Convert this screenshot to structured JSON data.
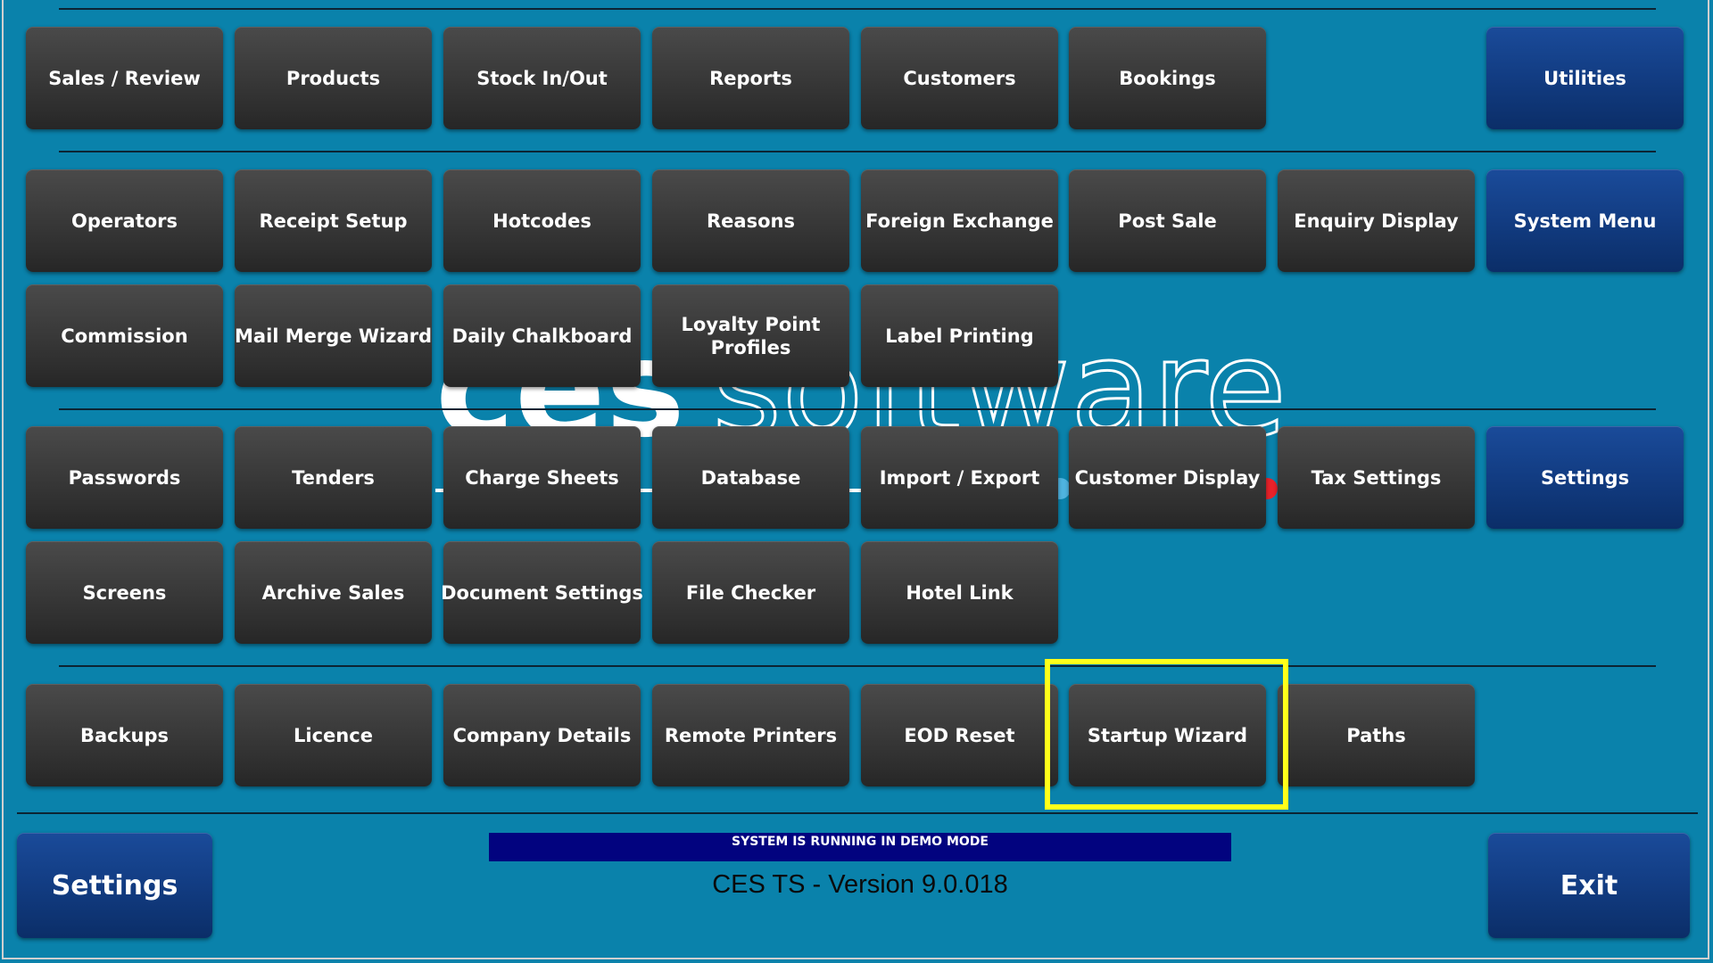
{
  "watermark": {
    "brand_bold": "ces",
    "brand_light": "software"
  },
  "rows": {
    "row1": [
      "Sales / Review",
      "Products",
      "Stock In/Out",
      "Reports",
      "Customers",
      "Bookings"
    ],
    "row1_utility": "Utilities",
    "row2": [
      "Operators",
      "Receipt Setup",
      "Hotcodes",
      "Reasons",
      "Foreign Exchange",
      "Post Sale",
      "Enquiry Display"
    ],
    "row2_menu": "System Menu",
    "row3": [
      "Commission",
      "Mail Merge Wizard",
      "Daily Chalkboard",
      "Loyalty Point Profiles",
      "Label Printing"
    ],
    "row4": [
      "Passwords",
      "Tenders",
      "Charge Sheets",
      "Database",
      "Import / Export",
      "Customer Display",
      "Tax Settings"
    ],
    "row4_settings": "Settings",
    "row5": [
      "Screens",
      "Archive Sales",
      "Document Settings",
      "File Checker",
      "Hotel Link"
    ],
    "row6": [
      "Backups",
      "Licence",
      "Company Details",
      "Remote Printers",
      "EOD Reset",
      "Startup Wizard",
      "Paths"
    ]
  },
  "footer": {
    "settings_label": "Settings",
    "exit_label": "Exit",
    "demo_banner": "SYSTEM IS RUNNING IN DEMO MODE",
    "version": "CES TS - Version 9.0.018"
  },
  "colors": {
    "background": "#0a82ab",
    "button_dark": "#333333",
    "button_blue": "#123c82",
    "highlight": "#ffff1a",
    "demo_banner": "#02037f"
  }
}
